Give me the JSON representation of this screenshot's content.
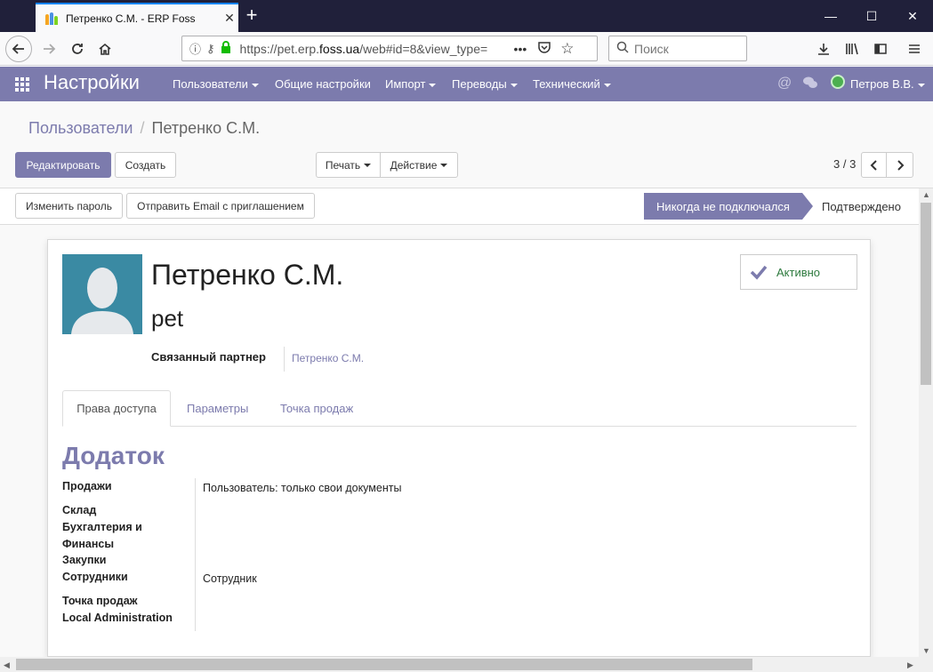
{
  "browser": {
    "tab_title": "Петренко С.М. - ERP Foss",
    "url_prefix": "https://pet.erp.",
    "url_domain": "foss.ua",
    "url_suffix": "/web#id=8&view_type=",
    "search_placeholder": "Поиск",
    "more_dots": "•••"
  },
  "app": {
    "brand": "Настройки",
    "menu": [
      {
        "label": "Пользователи"
      },
      {
        "label": "Общие настройки"
      },
      {
        "label": "Импорт"
      },
      {
        "label": "Переводы"
      },
      {
        "label": "Технический"
      }
    ],
    "user_name": "Петров В.В."
  },
  "control": {
    "breadcrumb_parent": "Пользователи",
    "breadcrumb_sep": "/",
    "breadcrumb_current": "Петренко С.М.",
    "edit_label": "Редактировать",
    "create_label": "Создать",
    "print_label": "Печать",
    "action_label": "Действие",
    "pager": "3 / 3"
  },
  "statusbar": {
    "change_password": "Изменить пароль",
    "send_invite": "Отправить Email с приглашением",
    "stage_active": "Никогда не подключался",
    "stage_other": "Подтверждено"
  },
  "form": {
    "name": "Петренко С.М.",
    "login": "pet",
    "partner_label": "Связанный партнер",
    "partner_value": "Петренко С.М.",
    "active_label": "Активно",
    "tabs": [
      "Права доступа",
      "Параметры",
      "Точка продаж"
    ],
    "section_title": "Додаток",
    "groups": [
      {
        "label": "Продажи",
        "value": "Пользователь: только свои документы"
      },
      {
        "label": "Склад",
        "value": ""
      },
      {
        "label": "Бухгалтерия и Финансы",
        "value": ""
      },
      {
        "label": "Закупки",
        "value": ""
      },
      {
        "label": "Сотрудники",
        "value": "Сотрудник"
      },
      {
        "label": "Точка продаж",
        "value": ""
      },
      {
        "label": "Local Administration",
        "value": ""
      }
    ]
  },
  "colors": {
    "accent": "#7c7bad",
    "active_green": "#2d7a3e"
  }
}
